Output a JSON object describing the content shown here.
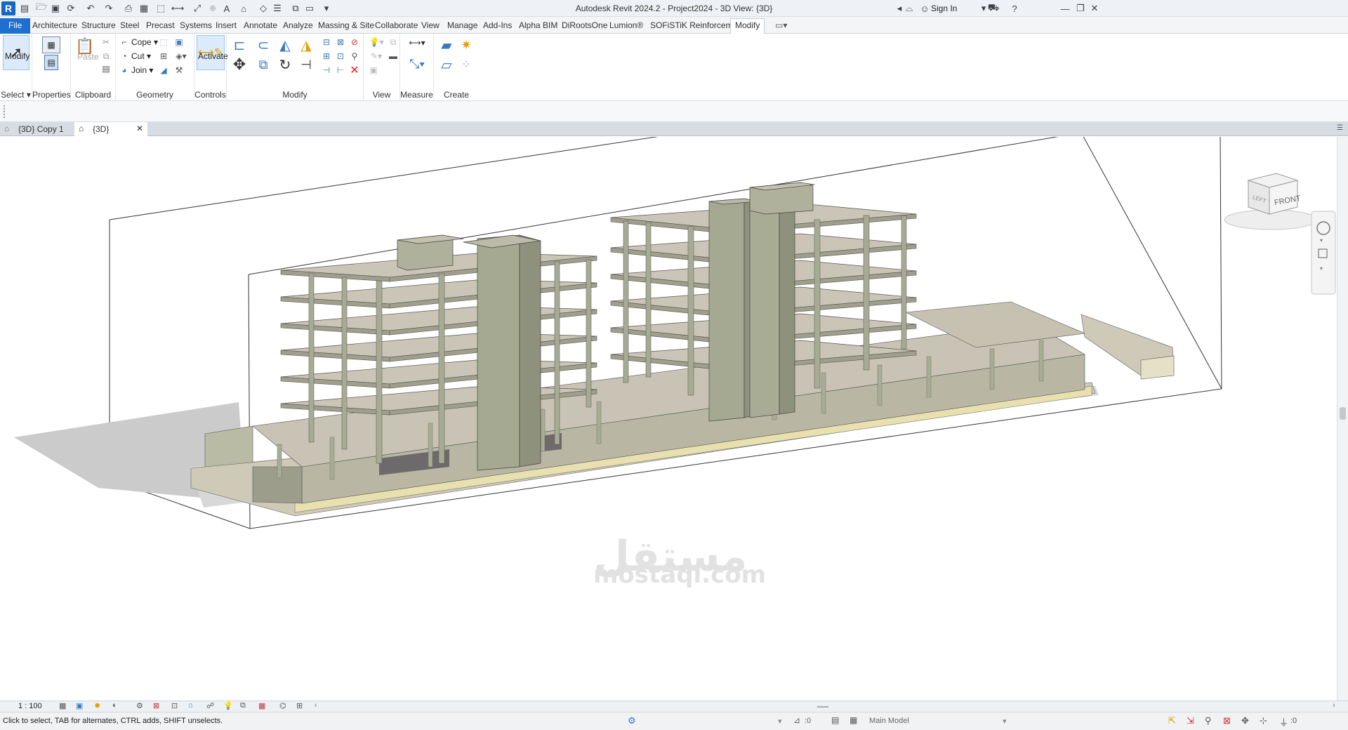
{
  "window": {
    "title": "Autodesk Revit 2024.2 - Project2024 - 3D View: {3D}",
    "sign_in": "Sign In"
  },
  "menu_tabs": [
    "File",
    "Architecture",
    "Structure",
    "Steel",
    "Precast",
    "Systems",
    "Insert",
    "Annotate",
    "Analyze",
    "Massing & Site",
    "Collaborate",
    "View",
    "Manage",
    "Add-Ins",
    "Alpha BIM",
    "DiRootsOne",
    "Lumion®",
    "SOFiSTiK Reinforcement",
    "Modify"
  ],
  "active_tab": "Modify",
  "ribbon": {
    "select": {
      "modify_label": "Modify",
      "panel_label": "Select"
    },
    "properties": {
      "label": "Properties"
    },
    "clipboard": {
      "paste_label": "Paste",
      "panel_label": "Clipboard"
    },
    "geometry": {
      "cope": "Cope",
      "cut": "Cut",
      "join": "Join",
      "panel_label": "Geometry"
    },
    "controls": {
      "activate": "Activate",
      "panel_label": "Controls"
    },
    "modify": {
      "panel_label": "Modify"
    },
    "view": {
      "panel_label": "View"
    },
    "measure": {
      "panel_label": "Measure"
    },
    "create": {
      "panel_label": "Create"
    }
  },
  "view_tabs": [
    {
      "label": "{3D} Copy 1",
      "active": false
    },
    {
      "label": "{3D}",
      "active": true
    }
  ],
  "viewcube": {
    "front": "FRONT",
    "left": "LEFT"
  },
  "watermark": {
    "arabic": "مستقل",
    "latin": "mostaql.com"
  },
  "view_control": {
    "scale": "1 : 100"
  },
  "status": {
    "hint": "Click to select, TAB for alternates, CTRL adds, SHIFT unselects.",
    "worksets": ":0",
    "model": "Main Model",
    "filter_count": ":0"
  },
  "colors": {
    "accent": "#1e6fd0",
    "concrete": "#c9c4b5",
    "column": "#a8ab94",
    "wall": "#b8b9a2",
    "shadow": "#cfcfcf",
    "footing": "#e9e0b0"
  }
}
